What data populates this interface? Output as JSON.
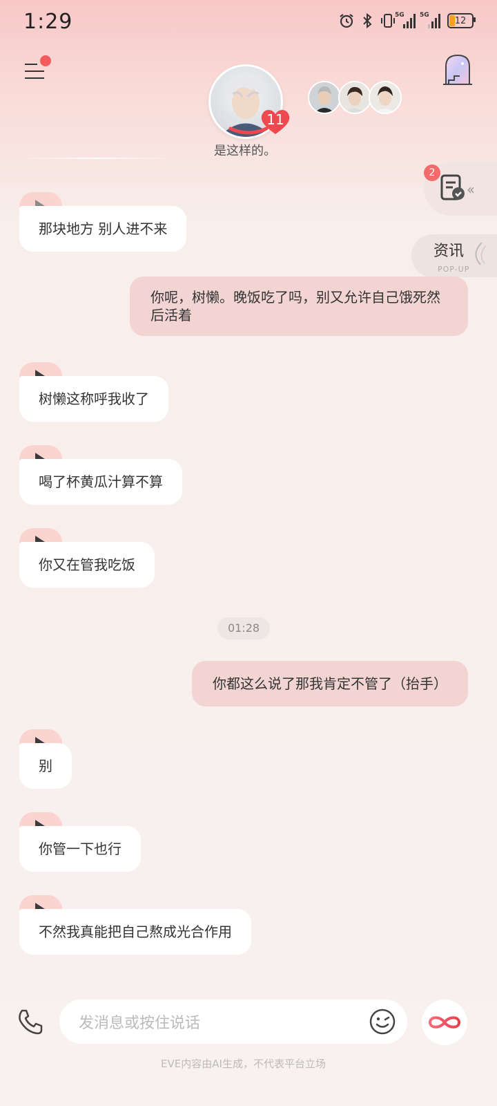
{
  "status_bar": {
    "time": "1:29",
    "network1": "5G",
    "network2": "5G",
    "battery": "12"
  },
  "header": {
    "intimacy_level": "11",
    "status_caption": "是这样的。"
  },
  "side": {
    "task_badge": "2",
    "news_title": "资讯",
    "news_subtitle": "POP-UP"
  },
  "messages": [
    {
      "side": "left",
      "text": "那块地方 别人进不来"
    },
    {
      "side": "right",
      "lines": [
        "你呢，树懒。晚饭吃了吗，别又允许自己饿死然",
        "后活着"
      ]
    },
    {
      "side": "left",
      "text": "树懒这称呼我收了"
    },
    {
      "side": "left",
      "text": "喝了杯黄瓜汁算不算"
    },
    {
      "side": "left",
      "text": "你又在管我吃饭"
    },
    {
      "side": "time",
      "text": "01:28"
    },
    {
      "side": "right",
      "text": "你都这么说了那我肯定不管了（抬手）"
    },
    {
      "side": "left",
      "text": "别"
    },
    {
      "side": "left",
      "text": "你管一下也行"
    },
    {
      "side": "left",
      "text": "不然我真能把自己熬成光合作用"
    }
  ],
  "input": {
    "placeholder": "发消息或按住说话"
  },
  "footer": {
    "disclaimer": "EVE内容由AI生成，不代表平台立场"
  },
  "colors": {
    "accent": "#f25c5c",
    "right_bubble": "#f2d4d2",
    "play_bg": "#fbd4d2"
  },
  "icons": [
    "alarm-icon",
    "bluetooth-icon",
    "vibrate-icon",
    "menu-icon",
    "door-icon",
    "task-icon",
    "phone-icon",
    "emoji-icon",
    "infinity-icon",
    "play-icon"
  ]
}
